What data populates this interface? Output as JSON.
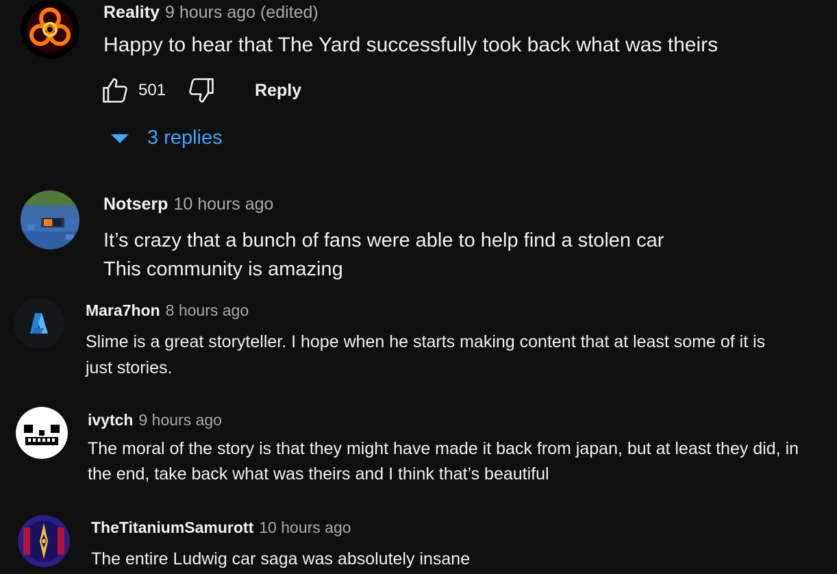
{
  "comments": [
    {
      "author": "Reality",
      "time": "9 hours ago (edited)",
      "lines": [
        "Happy to hear that The Yard successfully took back what was theirs"
      ],
      "avatar_icon": "biohazard-icon",
      "likes": "501",
      "reply_label": "Reply",
      "replies_label": "3 replies"
    },
    {
      "author": "Notserp",
      "time": "10 hours ago",
      "lines": [
        "It’s crazy that a bunch of fans were able to help find a stolen car",
        "This community is amazing"
      ],
      "avatar_icon": "minecraft-block-icon"
    },
    {
      "author": "Mara7hon",
      "time": "8 hours ago",
      "lines": [
        "Slime is a great storyteller. I hope when he starts making content that at least some of it is",
        "just stories."
      ],
      "avatar_icon": "letter-a-logo-icon"
    },
    {
      "author": "ivytch",
      "time": "9 hours ago",
      "lines": [
        "The moral of the story is that they might have made it back from japan, but at least they did, in",
        "the end, take back what was theirs and I think that’s beautiful"
      ],
      "avatar_icon": "skull-face-icon"
    },
    {
      "author": "TheTitaniumSamurott",
      "time": "10 hours ago",
      "lines": [
        "The entire Ludwig car saga was absolutely insane"
      ],
      "avatar_icon": "compass-star-icon"
    }
  ],
  "colors": {
    "background": "#0f0f0f",
    "text": "#f1f1f1",
    "secondary_text": "#aaaaaa",
    "link_blue": "#3ea6ff"
  }
}
